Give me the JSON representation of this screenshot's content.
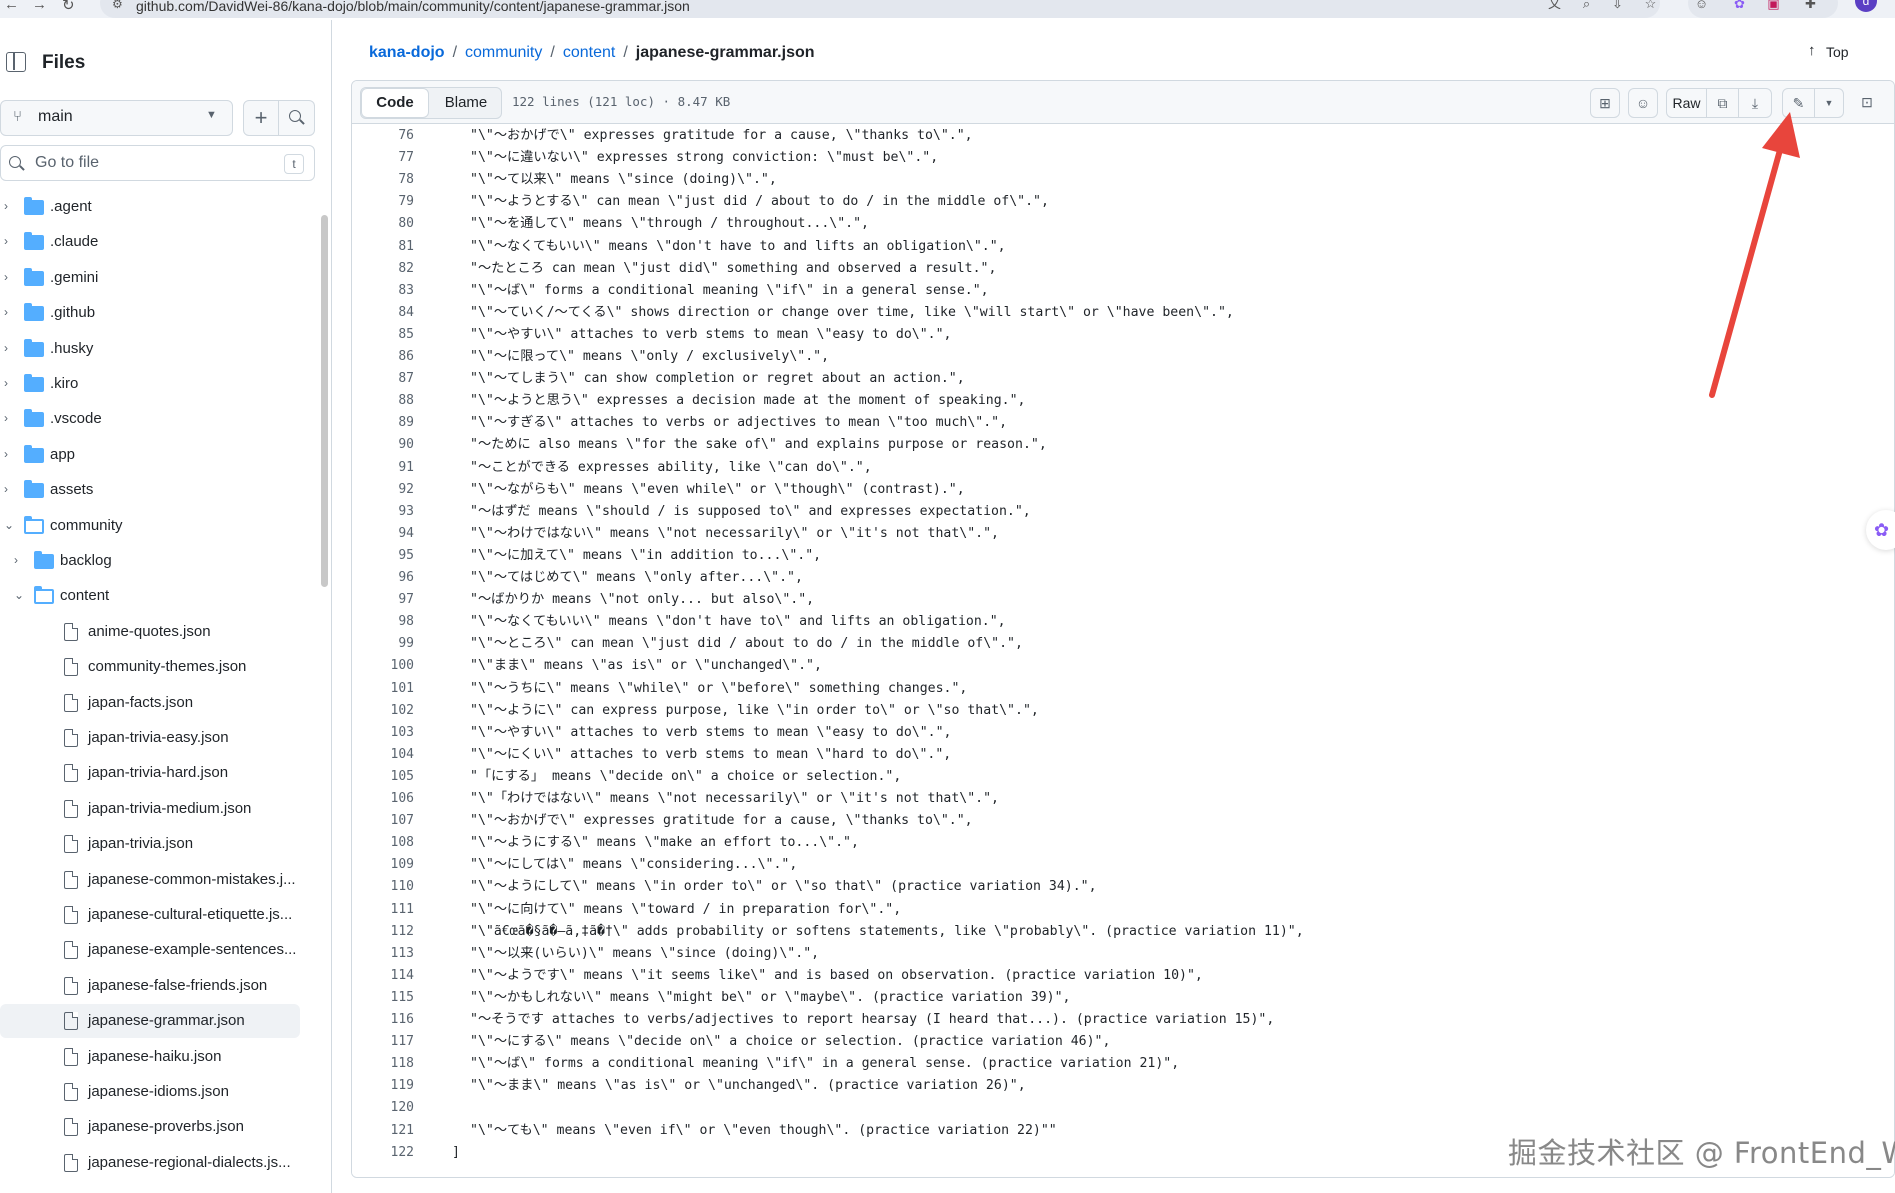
{
  "browser": {
    "url": "github.com/DavidWei-86/kana-dojo/blob/main/community/content/japanese-grammar.json",
    "profile_initial": "d"
  },
  "sidebar": {
    "title": "Files",
    "branch": "main",
    "goto_placeholder": "Go to file",
    "goto_shortcut": "t",
    "tree": [
      {
        "label": ".agent",
        "type": "folder",
        "depth": 0,
        "expanded": false
      },
      {
        "label": ".claude",
        "type": "folder",
        "depth": 0,
        "expanded": false
      },
      {
        "label": ".gemini",
        "type": "folder",
        "depth": 0,
        "expanded": false
      },
      {
        "label": ".github",
        "type": "folder",
        "depth": 0,
        "expanded": false
      },
      {
        "label": ".husky",
        "type": "folder",
        "depth": 0,
        "expanded": false
      },
      {
        "label": ".kiro",
        "type": "folder",
        "depth": 0,
        "expanded": false
      },
      {
        "label": ".vscode",
        "type": "folder",
        "depth": 0,
        "expanded": false
      },
      {
        "label": "app",
        "type": "folder",
        "depth": 0,
        "expanded": false
      },
      {
        "label": "assets",
        "type": "folder",
        "depth": 0,
        "expanded": false
      },
      {
        "label": "community",
        "type": "folder",
        "depth": 0,
        "expanded": true
      },
      {
        "label": "backlog",
        "type": "folder",
        "depth": 1,
        "expanded": false
      },
      {
        "label": "content",
        "type": "folder",
        "depth": 1,
        "expanded": true
      },
      {
        "label": "anime-quotes.json",
        "type": "file",
        "depth": 2
      },
      {
        "label": "community-themes.json",
        "type": "file",
        "depth": 2
      },
      {
        "label": "japan-facts.json",
        "type": "file",
        "depth": 2
      },
      {
        "label": "japan-trivia-easy.json",
        "type": "file",
        "depth": 2
      },
      {
        "label": "japan-trivia-hard.json",
        "type": "file",
        "depth": 2
      },
      {
        "label": "japan-trivia-medium.json",
        "type": "file",
        "depth": 2
      },
      {
        "label": "japan-trivia.json",
        "type": "file",
        "depth": 2
      },
      {
        "label": "japanese-common-mistakes.j...",
        "type": "file",
        "depth": 2
      },
      {
        "label": "japanese-cultural-etiquette.js...",
        "type": "file",
        "depth": 2
      },
      {
        "label": "japanese-example-sentences...",
        "type": "file",
        "depth": 2
      },
      {
        "label": "japanese-false-friends.json",
        "type": "file",
        "depth": 2
      },
      {
        "label": "japanese-grammar.json",
        "type": "file",
        "depth": 2,
        "active": true
      },
      {
        "label": "japanese-haiku.json",
        "type": "file",
        "depth": 2
      },
      {
        "label": "japanese-idioms.json",
        "type": "file",
        "depth": 2
      },
      {
        "label": "japanese-proverbs.json",
        "type": "file",
        "depth": 2
      },
      {
        "label": "japanese-regional-dialects.js...",
        "type": "file",
        "depth": 2
      }
    ]
  },
  "breadcrumb": {
    "repo": "kana-dojo",
    "parts": [
      "community",
      "content"
    ],
    "current": "japanese-grammar.json",
    "sep": "/"
  },
  "top_link": "Top",
  "file_header": {
    "code_tab": "Code",
    "blame_tab": "Blame",
    "meta": "122 lines (121 loc) · 8.47 KB",
    "raw_label": "Raw"
  },
  "code_lines": [
    {
      "n": "76",
      "text": "\"\\\"～おかげで\\\" expresses gratitude for a cause, \\\"thanks to\\\".\","
    },
    {
      "n": "77",
      "text": "\"\\\"～に違いない\\\" expresses strong conviction: \\\"must be\\\".\","
    },
    {
      "n": "78",
      "text": "\"\\\"～て以来\\\" means \\\"since (doing)\\\".\","
    },
    {
      "n": "79",
      "text": "\"\\\"～ようとする\\\" can mean \\\"just did / about to do / in the middle of\\\".\","
    },
    {
      "n": "80",
      "text": "\"\\\"～を通して\\\" means \\\"through / throughout...\\\".\","
    },
    {
      "n": "81",
      "text": "\"\\\"～なくてもいい\\\" means \\\"don't have to and lifts an obligation\\\".\","
    },
    {
      "n": "82",
      "text": "\"～たところ can mean \\\"just did\\\" something and observed a result.\","
    },
    {
      "n": "83",
      "text": "\"\\\"～ば\\\" forms a conditional meaning \\\"if\\\" in a general sense.\","
    },
    {
      "n": "84",
      "text": "\"\\\"～ていく/～てくる\\\" shows direction or change over time, like \\\"will start\\\" or \\\"have been\\\".\","
    },
    {
      "n": "85",
      "text": "\"\\\"～やすい\\\" attaches to verb stems to mean \\\"easy to do\\\".\","
    },
    {
      "n": "86",
      "text": "\"\\\"～に限って\\\" means \\\"only / exclusively\\\".\","
    },
    {
      "n": "87",
      "text": "\"\\\"～てしまう\\\" can show completion or regret about an action.\","
    },
    {
      "n": "88",
      "text": "\"\\\"～ようと思う\\\" expresses a decision made at the moment of speaking.\","
    },
    {
      "n": "89",
      "text": "\"\\\"～すぎる\\\" attaches to verbs or adjectives to mean \\\"too much\\\".\","
    },
    {
      "n": "90",
      "text": "\"～ために also means \\\"for the sake of\\\" and explains purpose or reason.\","
    },
    {
      "n": "91",
      "text": "\"～ことができる expresses ability, like \\\"can do\\\".\","
    },
    {
      "n": "92",
      "text": "\"\\\"～ながらも\\\" means \\\"even while\\\" or \\\"though\\\" (contrast).\","
    },
    {
      "n": "93",
      "text": "\"～はずだ means \\\"should / is supposed to\\\" and expresses expectation.\","
    },
    {
      "n": "94",
      "text": "\"\\\"～わけではない\\\" means \\\"not necessarily\\\" or \\\"it's not that\\\".\","
    },
    {
      "n": "95",
      "text": "\"\\\"～に加えて\\\" means \\\"in addition to...\\\".\","
    },
    {
      "n": "96",
      "text": "\"\\\"～てはじめて\\\" means \\\"only after...\\\".\","
    },
    {
      "n": "97",
      "text": "\"～ばかりか means \\\"not only... but also\\\".\","
    },
    {
      "n": "98",
      "text": "\"\\\"～なくてもいい\\\" means \\\"don't have to\\\" and lifts an obligation.\","
    },
    {
      "n": "99",
      "text": "\"\\\"～ところ\\\" can mean \\\"just did / about to do / in the middle of\\\".\","
    },
    {
      "n": "100",
      "text": "\"\\\"まま\\\" means \\\"as is\\\" or \\\"unchanged\\\".\","
    },
    {
      "n": "101",
      "text": "\"\\\"～うちに\\\" means \\\"while\\\" or \\\"before\\\" something changes.\","
    },
    {
      "n": "102",
      "text": "\"\\\"～ように\\\" can express purpose, like \\\"in order to\\\" or \\\"so that\\\".\","
    },
    {
      "n": "103",
      "text": "\"\\\"～やすい\\\" attaches to verb stems to mean \\\"easy to do\\\".\","
    },
    {
      "n": "104",
      "text": "\"\\\"～にくい\\\" attaches to verb stems to mean \\\"hard to do\\\".\","
    },
    {
      "n": "105",
      "text": "\"「にする」 means \\\"decide on\\\" a choice or selection.\","
    },
    {
      "n": "106",
      "text": "\"\\\"「わけではない\\\" means \\\"not necessarily\\\" or \\\"it's not that\\\".\","
    },
    {
      "n": "107",
      "text": "\"\\\"～おかげで\\\" expresses gratitude for a cause, \\\"thanks to\\\".\","
    },
    {
      "n": "108",
      "text": "\"\\\"～ようにする\\\" means \\\"make an effort to...\\\".\","
    },
    {
      "n": "109",
      "text": "\"\\\"～にしては\\\" means \\\"considering...\\\".\","
    },
    {
      "n": "110",
      "text": "\"\\\"～ようにして\\\" means \\\"in order to\\\" or \\\"so that\\\" (practice variation 34).\","
    },
    {
      "n": "111",
      "text": "\"\\\"～に向けて\\\" means \\\"toward / in preparation for\\\".\","
    },
    {
      "n": "112",
      "text": "\"\\\"ã€œã�§ã�—ã‚‡ã�†\\\" adds probability or softens statements, like \\\"probably\\\". (practice variation 11)\","
    },
    {
      "n": "113",
      "text": "\"\\\"～以来(いらい)\\\" means \\\"since (doing)\\\".\","
    },
    {
      "n": "114",
      "text": "\"\\\"～ようです\\\" means \\\"it seems like\\\" and is based on observation. (practice variation 10)\","
    },
    {
      "n": "115",
      "text": "\"\\\"～かもしれない\\\" means \\\"might be\\\" or \\\"maybe\\\". (practice variation 39)\","
    },
    {
      "n": "116",
      "text": "\"～そうです attaches to verbs/adjectives to report hearsay (I heard that...). (practice variation 15)\","
    },
    {
      "n": "117",
      "text": "\"\\\"～にする\\\" means \\\"decide on\\\" a choice or selection. (practice variation 46)\","
    },
    {
      "n": "118",
      "text": "\"\\\"～ば\\\" forms a conditional meaning \\\"if\\\" in a general sense. (practice variation 21)\","
    },
    {
      "n": "119",
      "text": "\"\\\"～まま\\\" means \\\"as is\\\" or \\\"unchanged\\\". (practice variation 26)\","
    },
    {
      "n": "120",
      "text": ""
    },
    {
      "n": "121",
      "text": "\"\\\"～ても\\\" means \\\"even if\\\" or \\\"even though\\\". (practice variation 22)\"\""
    },
    {
      "n": "122",
      "text": "]"
    }
  ],
  "watermark": "掘金技术社区 @ FrontEnd_Will",
  "colors": {
    "link": "#0969da",
    "folder": "#54aeff",
    "annotation_arrow": "#e8453c"
  }
}
